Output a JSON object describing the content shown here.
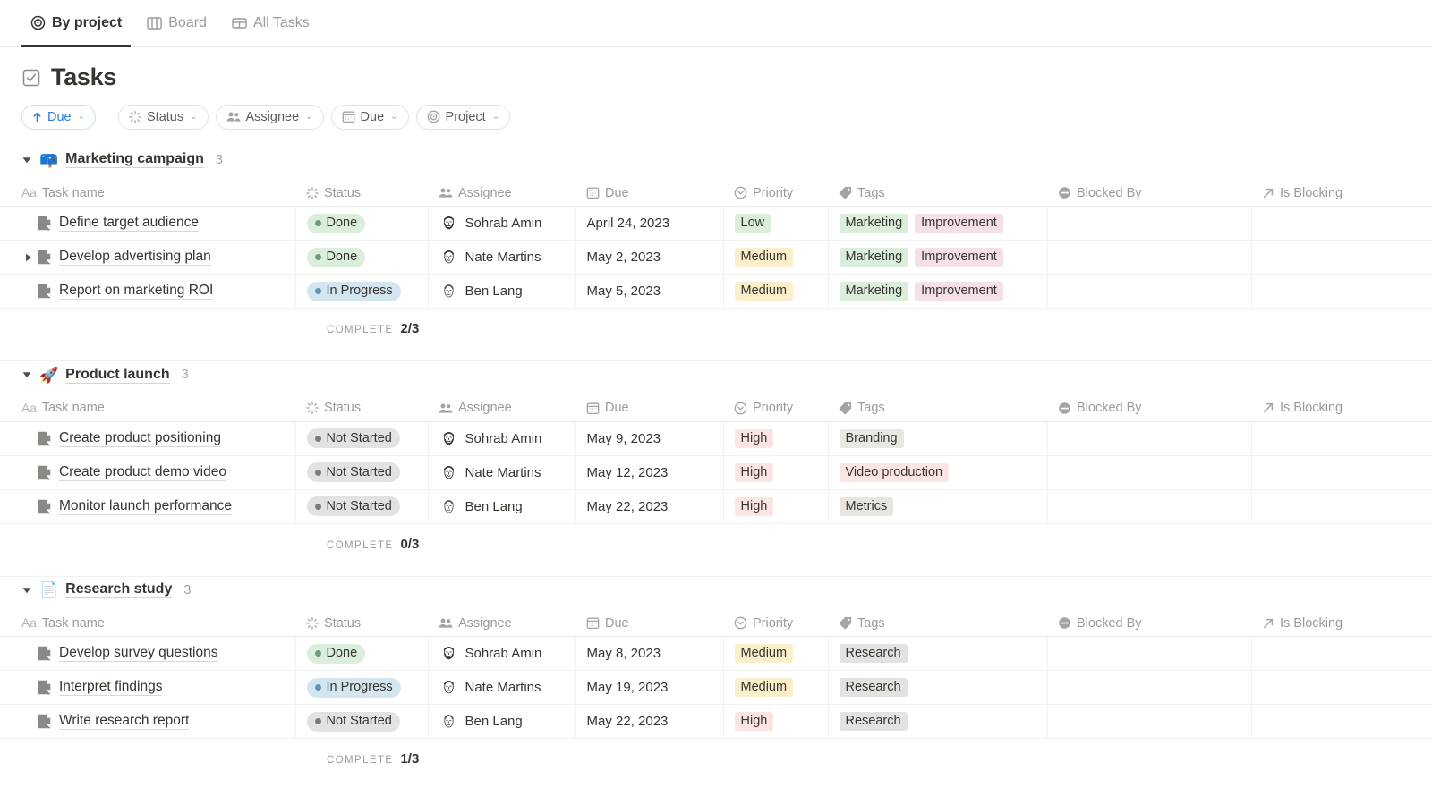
{
  "tabs": [
    {
      "label": "By project",
      "icon": "target-icon",
      "active": true
    },
    {
      "label": "Board",
      "icon": "board-columns-icon",
      "active": false
    },
    {
      "label": "All Tasks",
      "icon": "table-grid-icon",
      "active": false
    }
  ],
  "header": {
    "title": "Tasks",
    "icon": "checkbox-icon"
  },
  "filters": {
    "sort": {
      "label": "Due",
      "icon": "arrow-up-icon",
      "chevron": "⌄",
      "accent": "#2b7cd3",
      "border": "#c8def5"
    },
    "items": [
      {
        "label": "Status",
        "icon": "spinner-icon"
      },
      {
        "label": "Assignee",
        "icon": "people-icon"
      },
      {
        "label": "Due",
        "icon": "calendar-icon"
      },
      {
        "label": "Project",
        "icon": "target-icon"
      }
    ],
    "chevron": "⌄"
  },
  "columns": [
    {
      "label": "Task name",
      "icon": "aa-text-icon"
    },
    {
      "label": "Status",
      "icon": "spinner-icon"
    },
    {
      "label": "Assignee",
      "icon": "people-icon"
    },
    {
      "label": "Due",
      "icon": "calendar-icon"
    },
    {
      "label": "Priority",
      "icon": "priority-circle-icon"
    },
    {
      "label": "Tags",
      "icon": "tag-icon"
    },
    {
      "label": "Blocked By",
      "icon": "blocked-circle-icon"
    },
    {
      "label": "Is Blocking",
      "icon": "arrow-up-right-icon"
    }
  ],
  "complete_label": "COMPLETE",
  "colors": {
    "status_done_bg": "#dbeddb",
    "status_done_dot": "#6c9b7d",
    "status_done_text": "#37352f",
    "status_progress_bg": "#d3e5ef",
    "status_progress_dot": "#5b97bd",
    "status_notstarted_bg": "#e3e2e0",
    "status_notstarted_dot": "#7d7c78",
    "priority_low_bg": "#dbeddb",
    "priority_medium_bg": "#fbeeca",
    "priority_high_bg": "#fbe4e4",
    "tag_green_bg": "#dbeddb",
    "tag_pink_bg": "#f5e0e9",
    "tag_gray_bg": "#e3e2e0",
    "tag_red_bg": "#fbe4e4",
    "accent_blue": "#2b7cd3"
  },
  "groups": [
    {
      "name": "Marketing campaign",
      "emoji": "📪",
      "emoji_name": "mailbox-emoji",
      "count": "3",
      "complete": "2/3",
      "rows": [
        {
          "name": "Define target audience",
          "has_subtasks": false,
          "status": {
            "label": "Done",
            "bg": "#dbeddb",
            "dot": "#6c9b7d"
          },
          "assignee": "Sohrab Amin",
          "avatar": "avatar-sohrab",
          "due": "April 24, 2023",
          "priority": {
            "label": "Low",
            "bg": "#dbeddb"
          },
          "tags": [
            {
              "label": "Marketing",
              "bg": "#dbeddb"
            },
            {
              "label": "Improvement",
              "bg": "#f5e0e9"
            }
          ],
          "blocked_by": "",
          "is_blocking": ""
        },
        {
          "name": "Develop advertising plan",
          "has_subtasks": true,
          "status": {
            "label": "Done",
            "bg": "#dbeddb",
            "dot": "#6c9b7d"
          },
          "assignee": "Nate Martins",
          "avatar": "avatar-nate",
          "due": "May 2, 2023",
          "priority": {
            "label": "Medium",
            "bg": "#fbeeca"
          },
          "tags": [
            {
              "label": "Marketing",
              "bg": "#dbeddb"
            },
            {
              "label": "Improvement",
              "bg": "#f5e0e9"
            }
          ],
          "blocked_by": "",
          "is_blocking": ""
        },
        {
          "name": "Report on marketing ROI",
          "has_subtasks": false,
          "status": {
            "label": "In Progress",
            "bg": "#d3e5ef",
            "dot": "#5b97bd"
          },
          "assignee": "Ben Lang",
          "avatar": "avatar-ben",
          "due": "May 5, 2023",
          "priority": {
            "label": "Medium",
            "bg": "#fbeeca"
          },
          "tags": [
            {
              "label": "Marketing",
              "bg": "#dbeddb"
            },
            {
              "label": "Improvement",
              "bg": "#f5e0e9"
            }
          ],
          "blocked_by": "",
          "is_blocking": ""
        }
      ]
    },
    {
      "name": "Product launch",
      "emoji": "🚀",
      "emoji_name": "rocket-emoji",
      "count": "3",
      "complete": "0/3",
      "rows": [
        {
          "name": "Create product positioning",
          "has_subtasks": false,
          "status": {
            "label": "Not Started",
            "bg": "#e3e2e0",
            "dot": "#7d7c78"
          },
          "assignee": "Sohrab Amin",
          "avatar": "avatar-sohrab",
          "due": "May 9, 2023",
          "priority": {
            "label": "High",
            "bg": "#fbe4e4"
          },
          "tags": [
            {
              "label": "Branding",
              "bg": "#e8e7e4"
            }
          ],
          "blocked_by": "",
          "is_blocking": ""
        },
        {
          "name": "Create product demo video",
          "has_subtasks": false,
          "status": {
            "label": "Not Started",
            "bg": "#e3e2e0",
            "dot": "#7d7c78"
          },
          "assignee": "Nate Martins",
          "avatar": "avatar-nate",
          "due": "May 12, 2023",
          "priority": {
            "label": "High",
            "bg": "#fbe4e4"
          },
          "tags": [
            {
              "label": "Video production",
              "bg": "#fbe4e4"
            }
          ],
          "blocked_by": "",
          "is_blocking": ""
        },
        {
          "name": "Monitor launch performance",
          "has_subtasks": false,
          "status": {
            "label": "Not Started",
            "bg": "#e3e2e0",
            "dot": "#7d7c78"
          },
          "assignee": "Ben Lang",
          "avatar": "avatar-ben",
          "due": "May 22, 2023",
          "priority": {
            "label": "High",
            "bg": "#fbe4e4"
          },
          "tags": [
            {
              "label": "Metrics",
              "bg": "#e8e5e1"
            }
          ],
          "blocked_by": "",
          "is_blocking": ""
        }
      ]
    },
    {
      "name": "Research study",
      "emoji": "📄",
      "emoji_name": "page-emoji",
      "count": "3",
      "complete": "1/3",
      "rows": [
        {
          "name": "Develop survey questions",
          "has_subtasks": false,
          "status": {
            "label": "Done",
            "bg": "#dbeddb",
            "dot": "#6c9b7d"
          },
          "assignee": "Sohrab Amin",
          "avatar": "avatar-sohrab",
          "due": "May 8, 2023",
          "priority": {
            "label": "Medium",
            "bg": "#fbeeca"
          },
          "tags": [
            {
              "label": "Research",
              "bg": "#e3e2e0"
            }
          ],
          "blocked_by": "",
          "is_blocking": ""
        },
        {
          "name": "Interpret findings",
          "has_subtasks": false,
          "status": {
            "label": "In Progress",
            "bg": "#d3e5ef",
            "dot": "#5b97bd"
          },
          "assignee": "Nate Martins",
          "avatar": "avatar-nate",
          "due": "May 19, 2023",
          "priority": {
            "label": "Medium",
            "bg": "#fbeeca"
          },
          "tags": [
            {
              "label": "Research",
              "bg": "#e3e2e0"
            }
          ],
          "blocked_by": "",
          "is_blocking": ""
        },
        {
          "name": "Write research report",
          "has_subtasks": false,
          "status": {
            "label": "Not Started",
            "bg": "#e3e2e0",
            "dot": "#7d7c78"
          },
          "assignee": "Ben Lang",
          "avatar": "avatar-ben",
          "due": "May 22, 2023",
          "priority": {
            "label": "High",
            "bg": "#fbe4e4"
          },
          "tags": [
            {
              "label": "Research",
              "bg": "#e3e2e0"
            }
          ],
          "blocked_by": "",
          "is_blocking": ""
        }
      ]
    }
  ]
}
